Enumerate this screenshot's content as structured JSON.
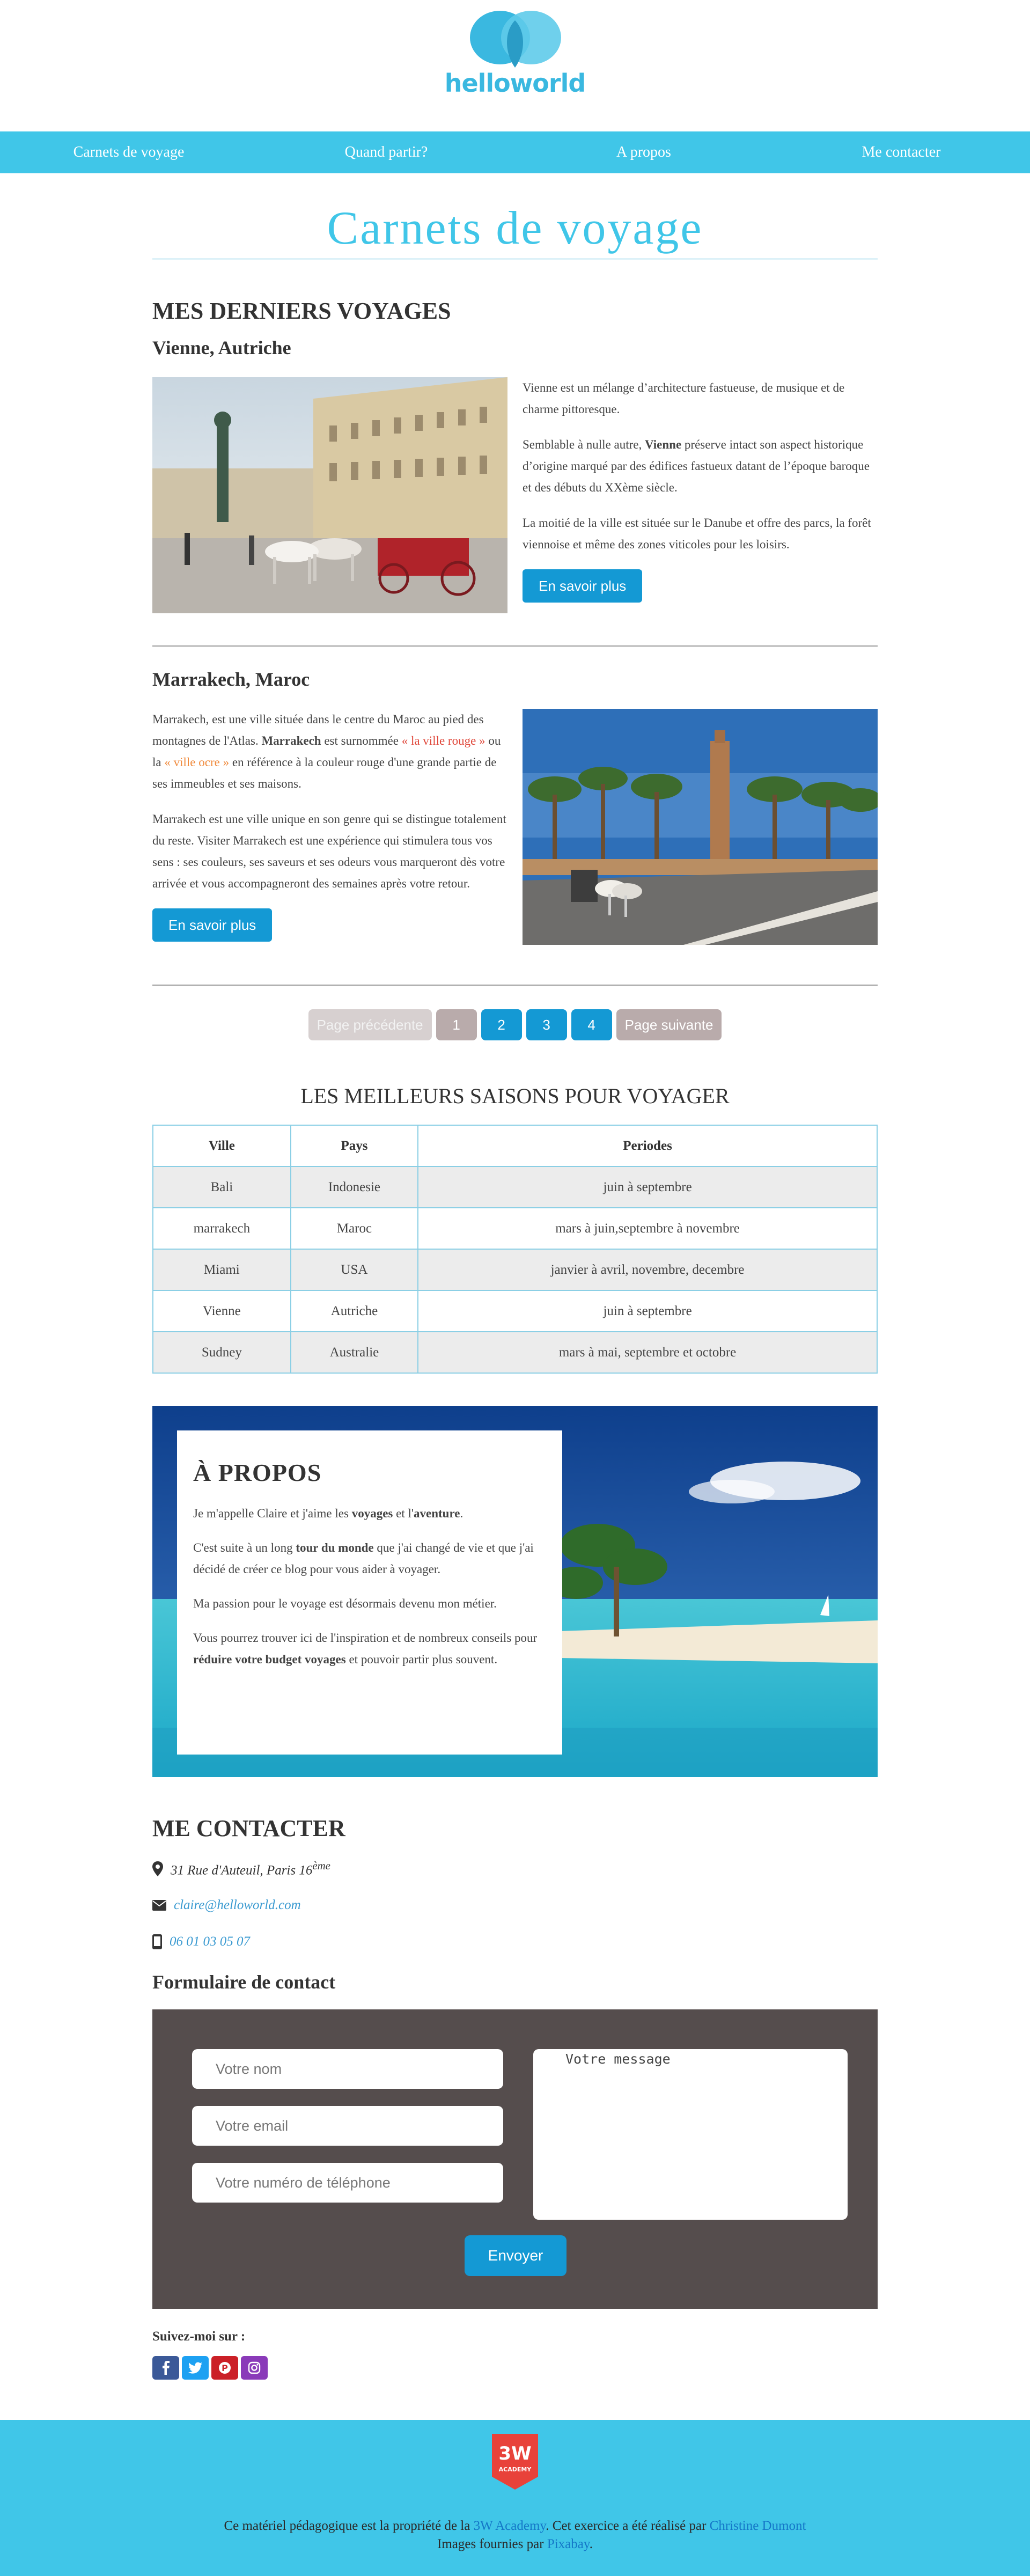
{
  "brand": {
    "logo_text": "helloworld"
  },
  "nav": {
    "items": [
      {
        "label": "Carnets de voyage"
      },
      {
        "label": "Quand partir?"
      },
      {
        "label": "A propos"
      },
      {
        "label": "Me contacter"
      }
    ]
  },
  "page_title": "Carnets  de  voyage",
  "trips_section": {
    "heading": "MES DERNIERS VOYAGES",
    "trips": [
      {
        "city": "Vienne, Autriche",
        "p1": "Vienne est un mélange d’architecture fastueuse, de musique et de charme pittoresque.",
        "p2_a": "Semblable à nulle autre, ",
        "p2_bold": "Vienne",
        "p2_b": " préserve intact son aspect historique d’origine marqué par des édifices fastueux datant de l’époque baroque et des débuts du XXème siècle.",
        "p3": "La moitié de la ville est située sur le Danube et offre des parcs, la forêt viennoise et même des zones viticoles pour les loisirs.",
        "button": "En savoir plus"
      },
      {
        "city": "Marrakech, Maroc",
        "p1_a": "Marrakech, est une ville située dans le centre du Maroc au pied des montagnes de l'Atlas. ",
        "p1_bold": "Marrakech",
        "p1_b": " est surnommée ",
        "p1_red": "« la ville rouge »",
        "p1_c": " ou la ",
        "p1_orange": "« ville ocre »",
        "p1_d": " en référence à la couleur rouge d'une grande partie de ses immeubles et ses maisons.",
        "p2": "Marrakech est une ville unique en son genre qui se distingue totalement du reste. Visiter Marrakech est une expérience qui stimulera tous vos sens : ses couleurs, ses saveurs et ses odeurs vous marqueront dès votre arrivée et vous accompagneront des semaines après votre retour.",
        "button": "En savoir plus"
      }
    ]
  },
  "pagination": {
    "prev": "Page précédente",
    "pages": [
      "1",
      "2",
      "3",
      "4"
    ],
    "next": "Page suivante"
  },
  "seasons": {
    "title": "LES MEILLEURS SAISONS POUR VOYAGER",
    "headers": [
      "Ville",
      "Pays",
      "Periodes"
    ],
    "rows": [
      [
        "Bali",
        "Indonesie",
        "juin à septembre"
      ],
      [
        "marrakech",
        "Maroc",
        "mars à juin,septembre à novembre"
      ],
      [
        "Miami",
        "USA",
        "janvier à avril, novembre, decembre"
      ],
      [
        "Vienne",
        "Autriche",
        "juin à septembre"
      ],
      [
        "Sudney",
        "Australie",
        "mars à mai, septembre et octobre"
      ]
    ]
  },
  "about": {
    "heading": "À PROPOS",
    "p1_a": "Je m'appelle Claire et j'aime les ",
    "p1_b1": "voyages",
    "p1_c": " et l'",
    "p1_b2": "aventure",
    "p1_d": ".",
    "p2_a": "C'est suite à un long ",
    "p2_b": "tour du monde",
    "p2_c": " que j'ai changé de vie et que j'ai décidé de créer ce blog pour vous aider à voyager.",
    "p3": "Ma passion pour le voyage est désormais devenu mon métier.",
    "p4_a": "Vous pourrez trouver ici de l'inspiration et de nombreux conseils pour ",
    "p4_b": "réduire votre budget voyages",
    "p4_c": " et pouvoir partir plus souvent."
  },
  "contact": {
    "heading": "ME CONTACTER",
    "address": "31 Rue d'Auteuil, Paris 16",
    "address_sup": "ème",
    "email": "claire@helloworld.com",
    "phone": "06 01 03 05 07",
    "form_title": "Formulaire de contact",
    "form": {
      "name_placeholder": "Votre nom",
      "email_placeholder": "Votre email",
      "phone_placeholder": "Votre numéro de téléphone",
      "message_placeholder": "Votre message",
      "submit": "Envoyer"
    },
    "follow_label": "Suivez-moi sur :"
  },
  "footer": {
    "badge_top": "3W",
    "badge_bottom": "ACADEMY",
    "line1_a": "Ce matériel pédagogique est la propriété de la ",
    "line1_link1": "3W Academy",
    "line1_b": ". Cet exercice a été réalisé par ",
    "line1_link2": "Christine Dumont",
    "line2_a": "Images fournies par ",
    "line2_link": "Pixabay",
    "line2_b": "."
  },
  "colors": {
    "accent": "#40c6e8",
    "button": "#1499d4",
    "form_bg": "#554d4d",
    "facebook": "#3b5998",
    "twitter": "#1da1f2",
    "pinterest": "#cb2027",
    "instagram": "#8a3ab9"
  },
  "icons": [
    "map-marker-icon",
    "envelope-icon",
    "mobile-phone-icon",
    "facebook-icon",
    "twitter-icon",
    "pinterest-icon",
    "instagram-icon"
  ]
}
